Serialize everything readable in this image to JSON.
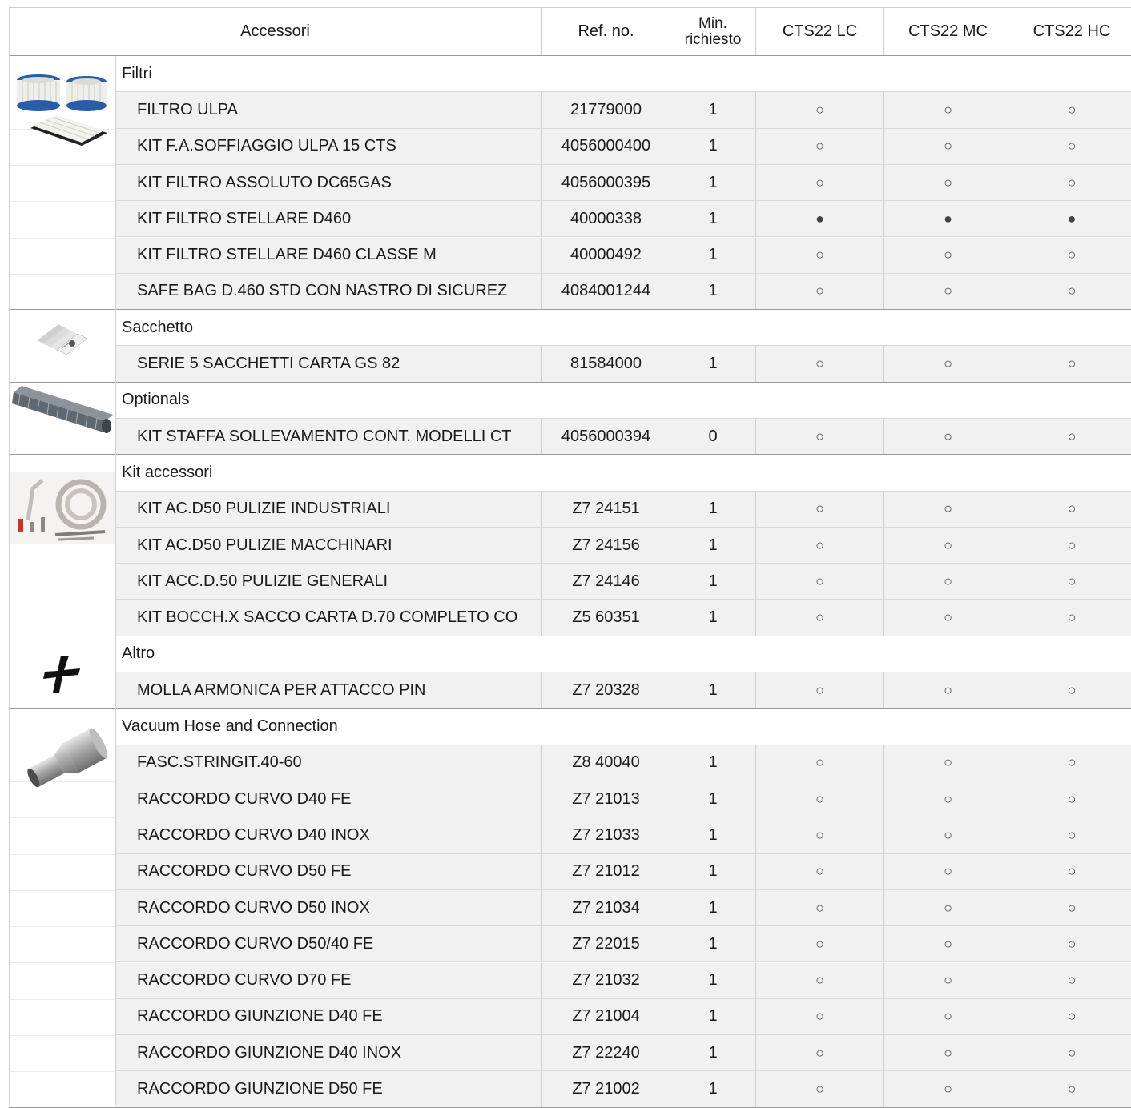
{
  "header": {
    "accessori": "Accessori",
    "ref": "Ref. no.",
    "min_line1": "Min.",
    "min_line2": "richiesto",
    "col_lc": "CTS22 LC",
    "col_mc": "CTS22 MC",
    "col_hc": "CTS22 HC"
  },
  "legend": {
    "optional_symbol": "○",
    "standard_symbol": "●"
  },
  "groups": [
    {
      "name": "Filtri",
      "image": "filter-cartridges-image",
      "items": [
        {
          "desc": "FILTRO ULPA",
          "ref": "21779000",
          "min": "1",
          "lc": "○",
          "mc": "○",
          "hc": "○"
        },
        {
          "desc": "KIT F.A.SOFFIAGGIO ULPA 15 CTS",
          "ref": "4056000400",
          "min": "1",
          "lc": "○",
          "mc": "○",
          "hc": "○"
        },
        {
          "desc": "KIT FILTRO ASSOLUTO DC65GAS",
          "ref": "4056000395",
          "min": "1",
          "lc": "○",
          "mc": "○",
          "hc": "○"
        },
        {
          "desc": "KIT FILTRO STELLARE D460",
          "ref": "40000338",
          "min": "1",
          "lc": "●",
          "mc": "●",
          "hc": "●"
        },
        {
          "desc": "KIT FILTRO STELLARE D460 CLASSE M",
          "ref": "40000492",
          "min": "1",
          "lc": "○",
          "mc": "○",
          "hc": "○"
        },
        {
          "desc": "SAFE BAG D.460 STD CON NASTRO DI SICUREZ",
          "ref": "4084001244",
          "min": "1",
          "lc": "○",
          "mc": "○",
          "hc": "○"
        }
      ]
    },
    {
      "name": "Sacchetto",
      "image": "paper-bags-image",
      "items": [
        {
          "desc": "SERIE 5 SACCHETTI CARTA GS 82",
          "ref": "81584000",
          "min": "1",
          "lc": "○",
          "mc": "○",
          "hc": "○"
        }
      ]
    },
    {
      "name": "Optionals",
      "image": "brush-roller-image",
      "items": [
        {
          "desc": "KIT STAFFA SOLLEVAMENTO CONT. MODELLI CT",
          "ref": "4056000394",
          "min": "0",
          "lc": "○",
          "mc": "○",
          "hc": "○"
        }
      ]
    },
    {
      "name": "Kit accessori",
      "image": "hose-kit-image",
      "items": [
        {
          "desc": "KIT AC.D50 PULIZIE INDUSTRIALI",
          "ref": "Z7 24151",
          "min": "1",
          "lc": "○",
          "mc": "○",
          "hc": "○"
        },
        {
          "desc": "KIT AC.D50 PULIZIE MACCHINARI",
          "ref": "Z7 24156",
          "min": "1",
          "lc": "○",
          "mc": "○",
          "hc": "○"
        },
        {
          "desc": "KIT ACC.D.50 PULIZIE GENERALI",
          "ref": "Z7 24146",
          "min": "1",
          "lc": "○",
          "mc": "○",
          "hc": "○"
        },
        {
          "desc": "KIT BOCCH.X SACCO CARTA D.70 COMPLETO CO",
          "ref": "Z5 60351",
          "min": "1",
          "lc": "○",
          "mc": "○",
          "hc": "○"
        }
      ]
    },
    {
      "name": "Altro",
      "image": "plus-icon",
      "items": [
        {
          "desc": "MOLLA ARMONICA PER ATTACCO PIN",
          "ref": "Z7 20328",
          "min": "1",
          "lc": "○",
          "mc": "○",
          "hc": "○"
        }
      ]
    },
    {
      "name": "Vacuum Hose and Connection",
      "image": "hose-connector-image",
      "items": [
        {
          "desc": "FASC.STRINGIT.40-60",
          "ref": "Z8 40040",
          "min": "1",
          "lc": "○",
          "mc": "○",
          "hc": "○"
        },
        {
          "desc": "RACCORDO CURVO D40 FE",
          "ref": "Z7 21013",
          "min": "1",
          "lc": "○",
          "mc": "○",
          "hc": "○"
        },
        {
          "desc": "RACCORDO CURVO D40 INOX",
          "ref": "Z7 21033",
          "min": "1",
          "lc": "○",
          "mc": "○",
          "hc": "○"
        },
        {
          "desc": "RACCORDO CURVO D50 FE",
          "ref": "Z7 21012",
          "min": "1",
          "lc": "○",
          "mc": "○",
          "hc": "○"
        },
        {
          "desc": "RACCORDO CURVO D50 INOX",
          "ref": "Z7 21034",
          "min": "1",
          "lc": "○",
          "mc": "○",
          "hc": "○"
        },
        {
          "desc": "RACCORDO CURVO D50/40 FE",
          "ref": "Z7 22015",
          "min": "1",
          "lc": "○",
          "mc": "○",
          "hc": "○"
        },
        {
          "desc": "RACCORDO CURVO D70 FE",
          "ref": "Z7 21032",
          "min": "1",
          "lc": "○",
          "mc": "○",
          "hc": "○"
        },
        {
          "desc": "RACCORDO GIUNZIONE D40 FE",
          "ref": "Z7 21004",
          "min": "1",
          "lc": "○",
          "mc": "○",
          "hc": "○"
        },
        {
          "desc": "RACCORDO GIUNZIONE D40 INOX",
          "ref": "Z7 22240",
          "min": "1",
          "lc": "○",
          "mc": "○",
          "hc": "○"
        },
        {
          "desc": "RACCORDO GIUNZIONE D50 FE",
          "ref": "Z7 21002",
          "min": "1",
          "lc": "○",
          "mc": "○",
          "hc": "○"
        }
      ]
    }
  ]
}
